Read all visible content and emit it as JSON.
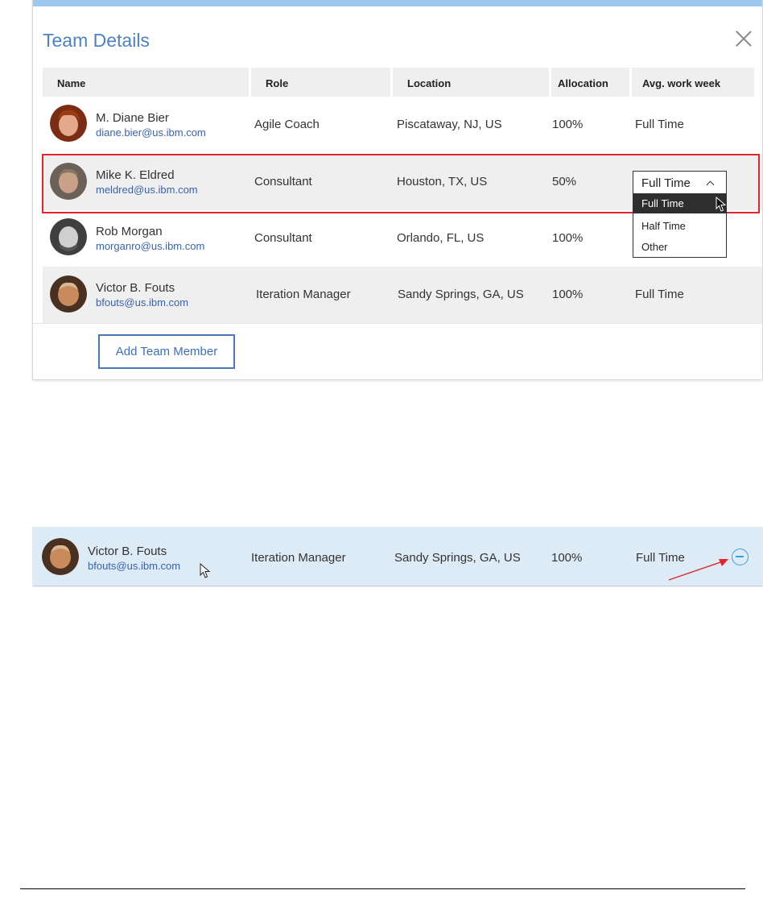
{
  "modal": {
    "title": "Team Details",
    "add_button_label": "Add Team Member",
    "columns": [
      "Name",
      "Role",
      "Location",
      "Allocation",
      "Avg. work week"
    ],
    "rows": [
      {
        "name": "M. Diane Bier",
        "email": "diane.bier@us.ibm.com",
        "role": "Agile Coach",
        "location": "Piscataway, NJ, US",
        "allocation": "100%",
        "work_week": "Full Time"
      },
      {
        "name": "Mike K. Eldred",
        "email": "meldred@us.ibm.com",
        "role": "Consultant",
        "location": "Houston, TX, US",
        "allocation": "50%",
        "work_week": "Full Time"
      },
      {
        "name": "Rob Morgan",
        "email": "morganro@us.ibm.com",
        "role": "Consultant",
        "location": "Orlando, FL, US",
        "allocation": "100%",
        "work_week": ""
      },
      {
        "name": "Victor B. Fouts",
        "email": "bfouts@us.ibm.com",
        "role": "Iteration Manager",
        "location": "Sandy Springs, GA, US",
        "allocation": "100%",
        "work_week": "Full Time"
      }
    ],
    "dropdown": {
      "selected": "Full Time",
      "options": [
        "Full Time",
        "Half Time",
        "Other"
      ],
      "highlighted": "Full Time"
    }
  },
  "hover_row": {
    "name": "Victor B. Fouts",
    "email": "bfouts@us.ibm.com",
    "role": "Iteration Manager",
    "location": "Sandy Springs, GA, US",
    "allocation": "100%",
    "work_week": "Full Time"
  },
  "colors": {
    "title_blue": "#4d82c8",
    "highlight_red": "#e3242b",
    "hover_row_bg": "#ddebf7",
    "remove_icon": "#3d9ee0"
  },
  "icons": [
    "close-icon",
    "chevron-up-icon",
    "cursor-icon",
    "minus-circle-icon",
    "arrow-annotation-icon"
  ]
}
